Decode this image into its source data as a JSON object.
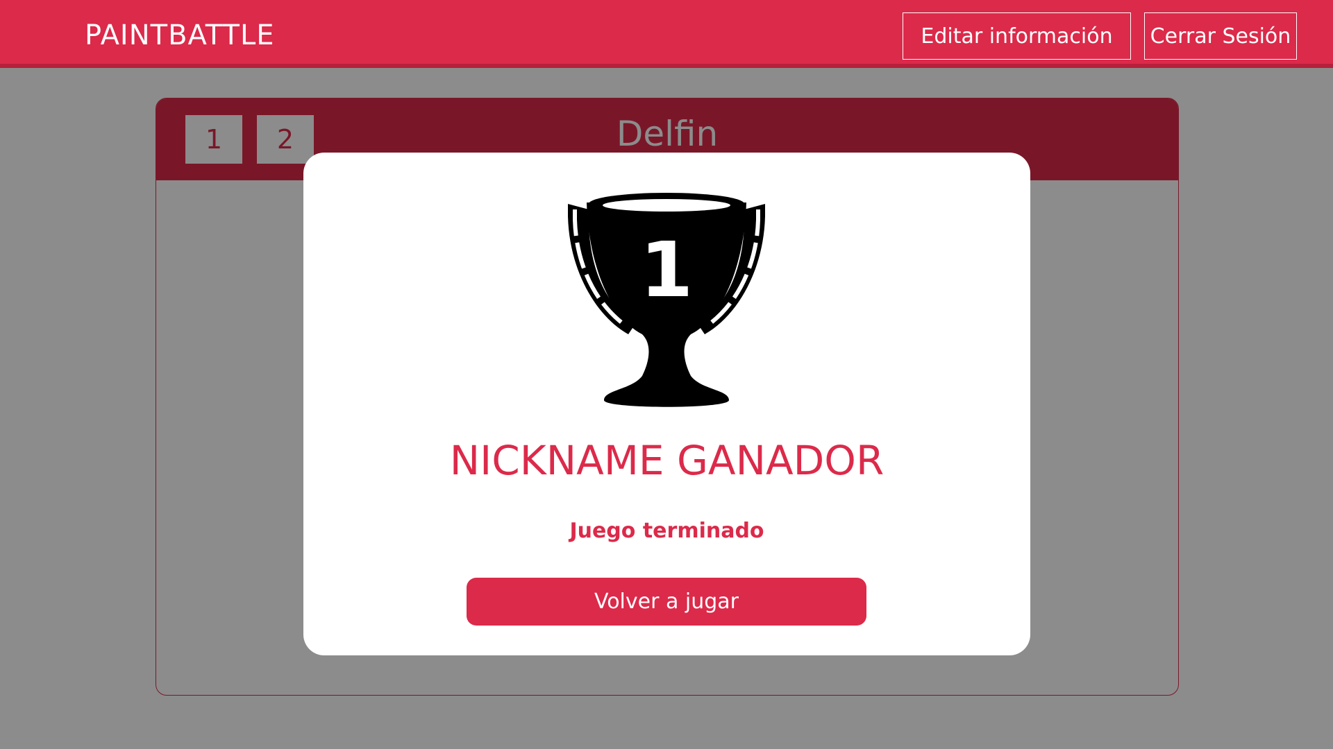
{
  "header": {
    "brand": "PAINTBATTLE",
    "edit_label": "Editar información",
    "logout_label": "Cerrar Sesión"
  },
  "game": {
    "pages": [
      "1",
      "2"
    ],
    "word": "Delfin"
  },
  "modal": {
    "trophy_number": "1",
    "winner": "NICKNAME GANADOR",
    "status": "Juego terminado",
    "play_again_label": "Volver a jugar"
  },
  "colors": {
    "accent": "#dc2a4a",
    "overlay": "rgba(0,0,0,0.45)",
    "trophy": "#000000"
  },
  "icons": {
    "trophy": "trophy-icon"
  }
}
